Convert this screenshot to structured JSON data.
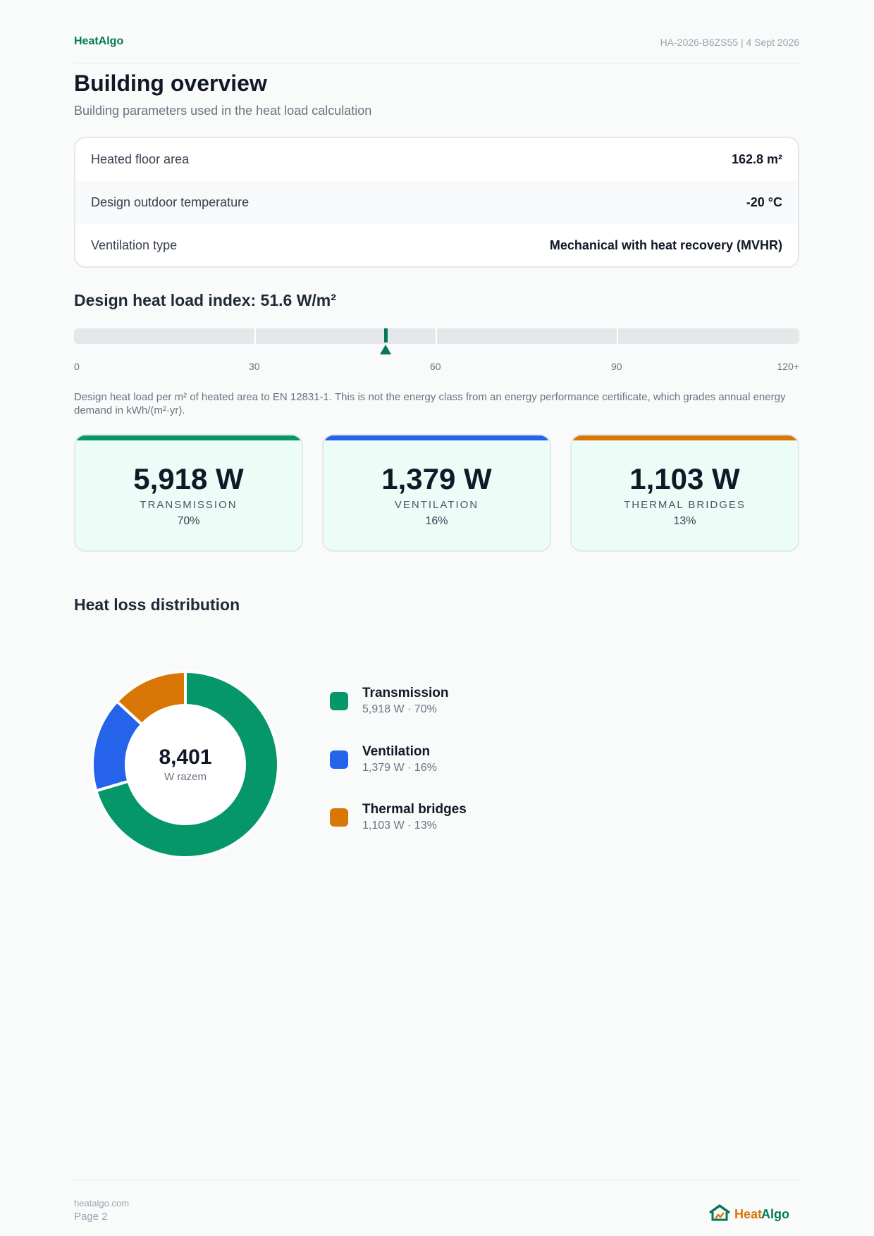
{
  "header": {
    "brand": "HeatAlgo",
    "doc_meta": "HA-2026-B6ZS55 | 4 Sept 2026"
  },
  "title": "Building overview",
  "subtitle": "Building parameters used in the heat load calculation",
  "params": [
    {
      "label": "Heated floor area",
      "value": "162.8 m²"
    },
    {
      "label": "Design outdoor temperature",
      "value": "-20 °C"
    },
    {
      "label": "Ventilation type",
      "value": "Mechanical with heat recovery (MVHR)"
    }
  ],
  "index": {
    "title": "Design heat load index: 51.6 W/m²",
    "value": 51.6,
    "scale_max": 120,
    "ticks": [
      "0",
      "30",
      "60",
      "90",
      "120+"
    ],
    "note": "Design heat load per m² of heated area to EN 12831-1. This is not the energy class from an energy performance certificate, which grades annual energy demand in kWh/(m²·yr)."
  },
  "cards": [
    {
      "value": "5,918 W",
      "label": "TRANSMISSION",
      "pct": "70%",
      "color": "#059669"
    },
    {
      "value": "1,379 W",
      "label": "VENTILATION",
      "pct": "16%",
      "color": "#2563eb"
    },
    {
      "value": "1,103 W",
      "label": "THERMAL BRIDGES",
      "pct": "13%",
      "color": "#d97706"
    }
  ],
  "distribution": {
    "title": "Heat loss distribution",
    "total": "8,401",
    "total_unit": "W razem",
    "legend": [
      {
        "name": "Transmission",
        "detail": "5,918 W · 70%"
      },
      {
        "name": "Ventilation",
        "detail": "1,379 W · 16%"
      },
      {
        "name": "Thermal bridges",
        "detail": "1,103 W · 13%"
      }
    ]
  },
  "chart_data": {
    "type": "pie",
    "categories": [
      "Transmission",
      "Ventilation",
      "Thermal bridges"
    ],
    "values": [
      5918,
      1379,
      1103
    ],
    "colors": [
      "#059669",
      "#2563eb",
      "#d97706"
    ]
  },
  "footer": {
    "site": "heatalgo.com",
    "page": "Page 2",
    "logo_part1": "Heat",
    "logo_part2": "Algo"
  }
}
